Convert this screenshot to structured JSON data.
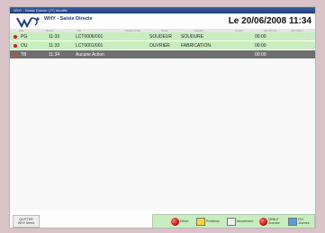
{
  "window": {
    "titlebar_text": "WHY - Saisie Directe (JT)  Modifié",
    "app_name": "WHY - Saisie Directe",
    "datetime": "Le 20/06/2008  11:34"
  },
  "column_headers": [
    "Etat",
    "Heure",
    "OF",
    "Libellé Poste",
    "Poste",
    "Activité",
    "Temps",
    "Qté Bonne",
    "Qté Rebut"
  ],
  "rows": [
    {
      "status": "PG",
      "time": "11:33",
      "of": "LCT0006/001",
      "poste": "SOUDEUR",
      "activite": "SOUDURE",
      "temps": "00:00"
    },
    {
      "status": "OU",
      "time": "11:33",
      "of": "LCT0001/001",
      "poste": "OUVRIER",
      "activite": "FABRICATION",
      "temps": "00:00"
    },
    {
      "status": "TB",
      "time": "11:34",
      "of": "Aucune Action",
      "poste": "",
      "activite": "",
      "temps": "00:00"
    }
  ],
  "buttons": {
    "quit": "QUITTER\nWHY Direct",
    "debut": "Début",
    "probleme": "Problème",
    "mouvement": "Mouvement",
    "debut_journee": "DEBUT\nJournée",
    "fin_journee": "FIN\nJournée"
  }
}
